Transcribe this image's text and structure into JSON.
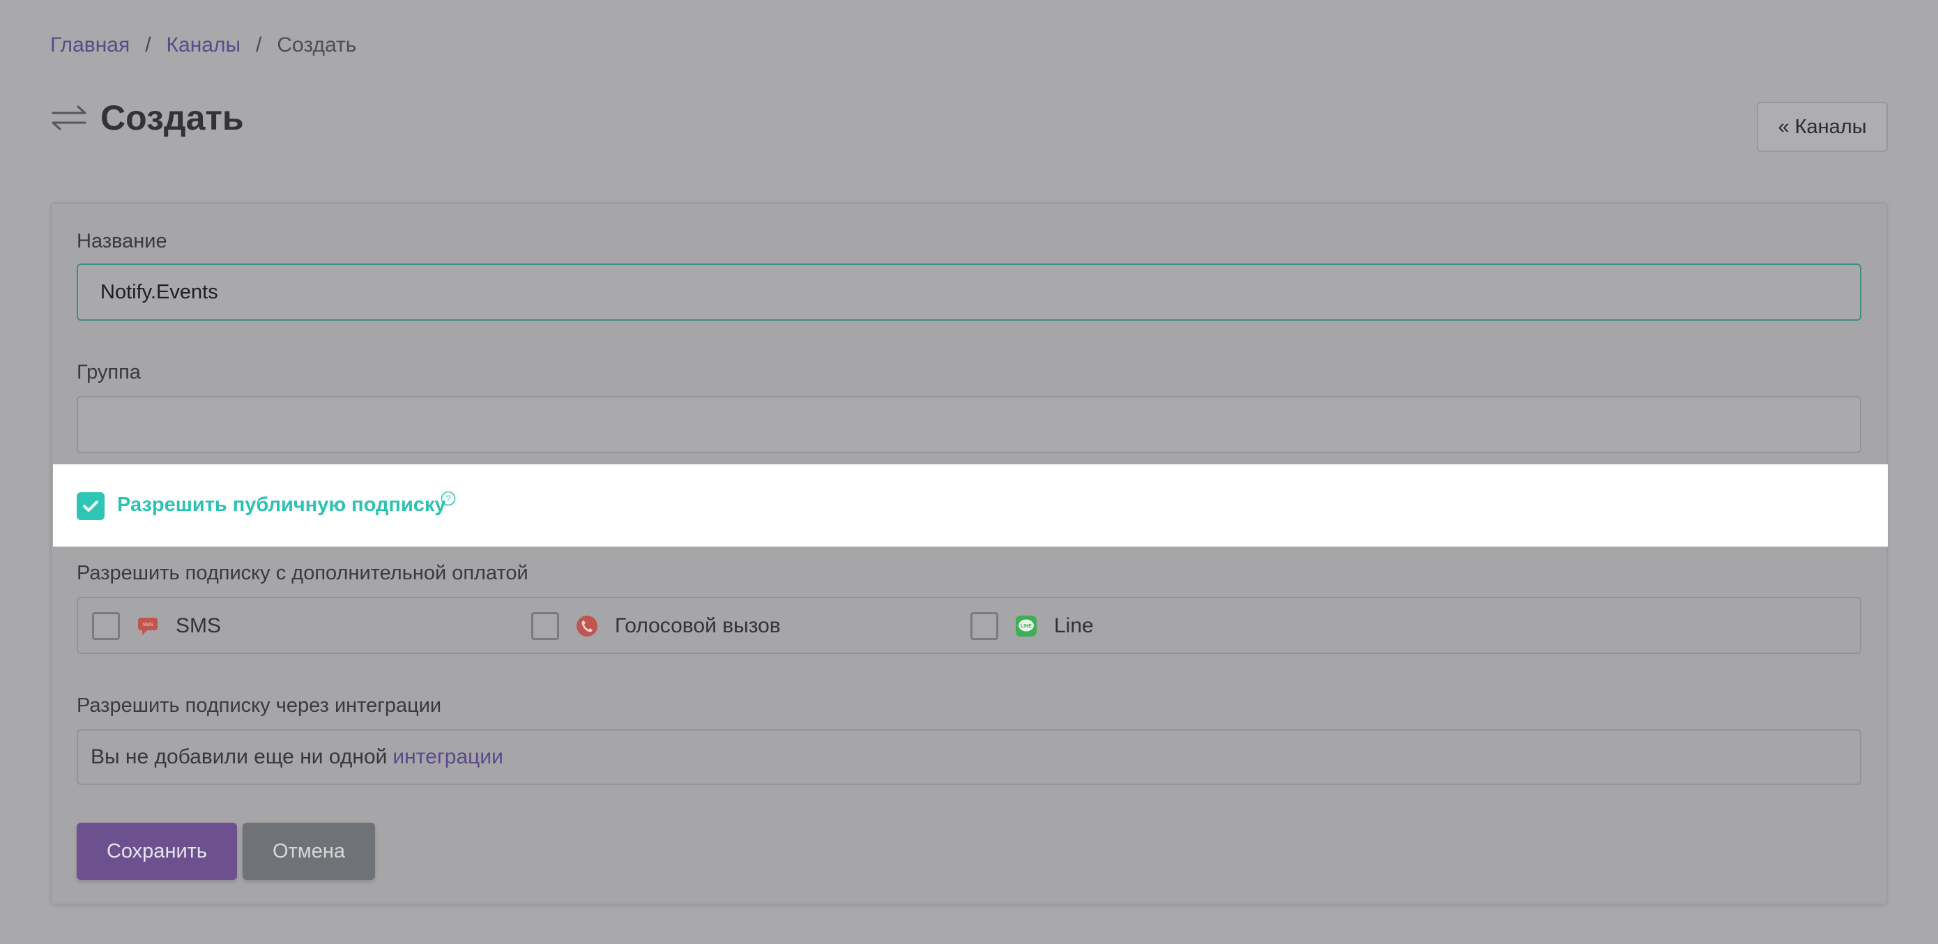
{
  "breadcrumb": {
    "home": "Главная",
    "channels": "Каналы",
    "current": "Создать"
  },
  "header": {
    "title": "Создать",
    "back_button": "« Каналы"
  },
  "form": {
    "name_label": "Название",
    "name_value": "Notify.Events",
    "group_label": "Группа",
    "group_value": "",
    "public_subscription_label": "Разрешить публичную подписку",
    "public_subscription_checked": true,
    "paid_label": "Разрешить подписку с дополнительной оплатой",
    "paid_options": [
      {
        "label": "SMS",
        "icon": "sms-icon",
        "color": "#c0554f",
        "checked": false
      },
      {
        "label": "Голосовой вызов",
        "icon": "phone-icon",
        "color": "#c0554f",
        "checked": false
      },
      {
        "label": "Line",
        "icon": "line-icon",
        "color": "#3fae55",
        "checked": false
      }
    ],
    "integrations_label": "Разрешить подписку через интеграции",
    "integrations_text": "Вы не добавили еще ни одной",
    "integrations_link": "интеграции",
    "save_button": "Сохранить",
    "cancel_button": "Отмена"
  },
  "colors": {
    "accent_purple": "#6d518f",
    "accent_teal": "#2fc5b4",
    "link": "#5a4a8a"
  }
}
